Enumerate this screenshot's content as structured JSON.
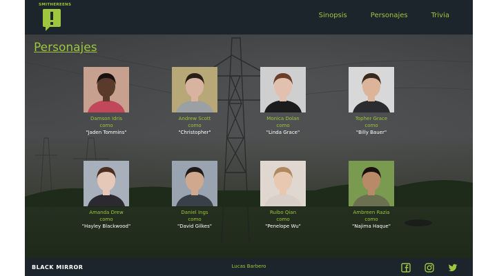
{
  "brand_logo_text": "SMITHEREENS",
  "nav": {
    "items": [
      "Sinopsis",
      "Personajes",
      "Trivia"
    ]
  },
  "page_title": "Personajes",
  "cast": [
    {
      "name": "Damson Idris",
      "como": "como",
      "role": "\"Jaden Tommins\"",
      "skin": "#5a3a2a",
      "bg": "#c8a090",
      "hair": "#1a1210",
      "shirt": "#c0485a"
    },
    {
      "name": "Andrew Scott",
      "como": "como",
      "role": "\"Christopher\"",
      "skin": "#d8b4a0",
      "bg": "#b8a878",
      "hair": "#2a1e18",
      "shirt": "#9aa0a4"
    },
    {
      "name": "Monica Dolan",
      "como": "como",
      "role": "\"Linda Grace\"",
      "skin": "#e2c0b0",
      "bg": "#cfcfcf",
      "hair": "#6a3e28",
      "shirt": "#1c1c1c"
    },
    {
      "name": "Topher Grace",
      "como": "como",
      "role": "\"Billy Bauer\"",
      "skin": "#dbb49a",
      "bg": "#d8d8d8",
      "hair": "#3a2a1e",
      "shirt": "#2a2c30"
    },
    {
      "name": "Amanda Drew",
      "como": "como",
      "role": "\"Hayley Blackwood\"",
      "skin": "#e6c8b8",
      "bg": "#a8b0bc",
      "hair": "#4a2e22",
      "shirt": "#2a2a30"
    },
    {
      "name": "Daniel Ings",
      "como": "como",
      "role": "\"David Gilkes\"",
      "skin": "#cfa88e",
      "bg": "#9aa4b0",
      "hair": "#1e1a18",
      "shirt": "#3a4048"
    },
    {
      "name": "Ruibo Qian",
      "como": "como",
      "role": "\"Penelope Wu\"",
      "skin": "#e8c8b0",
      "bg": "#e0d8d0",
      "hair": "#b08860",
      "shirt": "#d8d0c8"
    },
    {
      "name": "Ambreen Razia",
      "como": "como",
      "role": "\"Najima Haque\"",
      "skin": "#b88a68",
      "bg": "#7a9a50",
      "hair": "#1a1210",
      "shirt": "#6a7050"
    }
  ],
  "footer": {
    "brand": "BLACK MIRROR",
    "author": "Lucas Barbero",
    "social": [
      "facebook-icon",
      "instagram-icon",
      "twitter-icon"
    ]
  },
  "colors": {
    "accent": "#9ec63f",
    "header_bg": "#1c252c",
    "text_white": "#ffffff"
  }
}
